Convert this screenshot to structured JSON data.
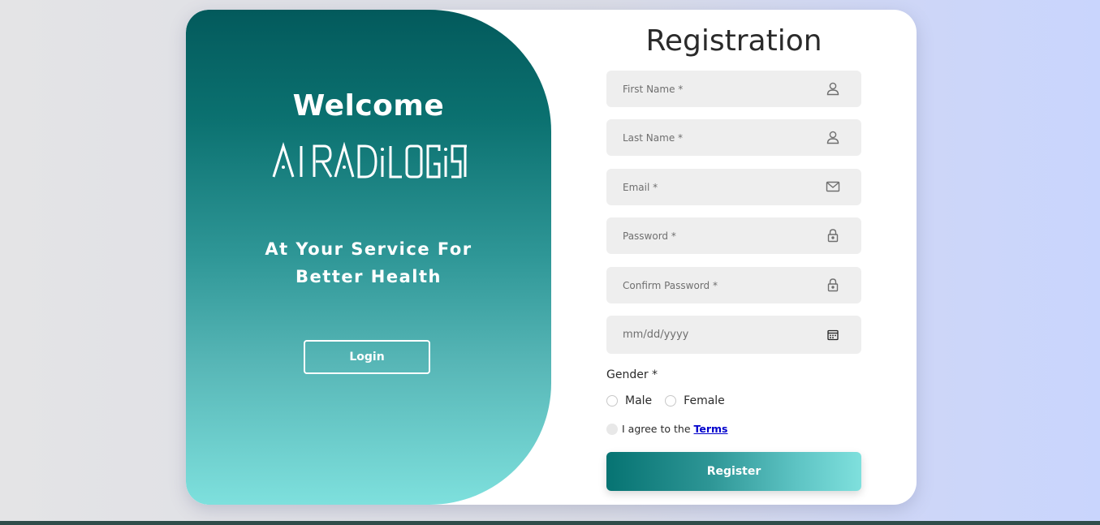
{
  "left": {
    "welcome": "Welcome",
    "brand_text": "AI RADILOGIST",
    "tagline_line1": "At Your Service For",
    "tagline_line2": "Better Health",
    "login_label": "Login"
  },
  "form": {
    "title": "Registration",
    "fields": [
      {
        "placeholder": "First Name *",
        "icon": "user-icon"
      },
      {
        "placeholder": "Last Name *",
        "icon": "user-icon"
      },
      {
        "placeholder": "Email *",
        "icon": "mail-icon"
      },
      {
        "placeholder": "Password *",
        "icon": "lock-icon"
      },
      {
        "placeholder": "Confirm Password *",
        "icon": "lock-icon"
      },
      {
        "placeholder": "mm/dd/yyyy",
        "icon": "calendar-icon"
      }
    ],
    "gender_label": "Gender *",
    "gender_options": [
      "Male",
      "Female"
    ],
    "terms_prefix": "I agree to the",
    "terms_link": "Terms",
    "register_label": "Register"
  },
  "colors": {
    "teal_dark": "#035a5c",
    "teal_light": "#7ee0dd",
    "link": "#0000cc"
  }
}
